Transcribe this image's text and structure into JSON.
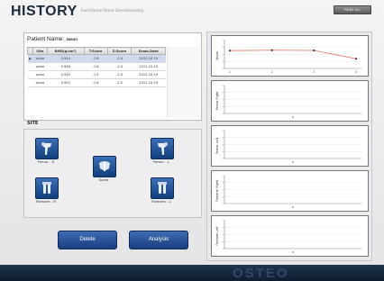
{
  "header": {
    "title": "HISTORY",
    "subtitle": "Functional Bone Densitometry",
    "top_button": "PRINT ALL"
  },
  "patient": {
    "label": "Patient Name:",
    "name": "Jason"
  },
  "records": {
    "columns": [
      "Site",
      "BMD(g/cm²)",
      "T-Score",
      "Z-Score",
      "Exam.Date"
    ],
    "rows": [
      {
        "site": "spine",
        "bmd": "0.944",
        "t": "-1.6",
        "z": "-1.4",
        "date": "2012-10-19",
        "selected": true
      },
      {
        "site": "spine",
        "bmd": "0.946",
        "t": "-1.6",
        "z": "-1.4",
        "date": "2012-10-19",
        "selected": false
      },
      {
        "site": "spine",
        "bmd": "0.945",
        "t": "-1.5",
        "z": "-1.4",
        "date": "2012-10-19",
        "selected": false
      },
      {
        "site": "spine",
        "bmd": "0.902",
        "t": "-1.6",
        "z": "-1.5",
        "date": "2012-10-19",
        "selected": false
      }
    ]
  },
  "site": {
    "label": "SITE",
    "buttons": {
      "femur_r": "Femur - R",
      "femur_l": "Femur - L",
      "spine": "Spine",
      "forearm_r": "Forearm - R",
      "forearm_l": "Forearm - L"
    }
  },
  "actions": {
    "delete": "Delete",
    "analysis": "Analysis"
  },
  "chart_data": [
    {
      "type": "line",
      "ylabel": "Spine",
      "x": [
        1,
        2,
        3,
        4
      ],
      "values": [
        0.944,
        0.946,
        0.945,
        0.902
      ],
      "color": "#e07060"
    },
    {
      "type": "line",
      "ylabel": "Femur Right",
      "x": [],
      "values": []
    },
    {
      "type": "line",
      "ylabel": "Femur Left",
      "x": [],
      "values": []
    },
    {
      "type": "line",
      "ylabel": "Forearm Right",
      "x": [],
      "values": []
    },
    {
      "type": "line",
      "ylabel": "Forearm Left",
      "x": [],
      "values": []
    }
  ],
  "footer": {
    "brand": "OSTEO"
  },
  "colors": {
    "accent": "#1e4a8c",
    "footer": "#14243a"
  },
  "icons": {
    "femur": "femur-bone-icon",
    "spine": "spine-icon",
    "forearm": "forearm-icon"
  }
}
